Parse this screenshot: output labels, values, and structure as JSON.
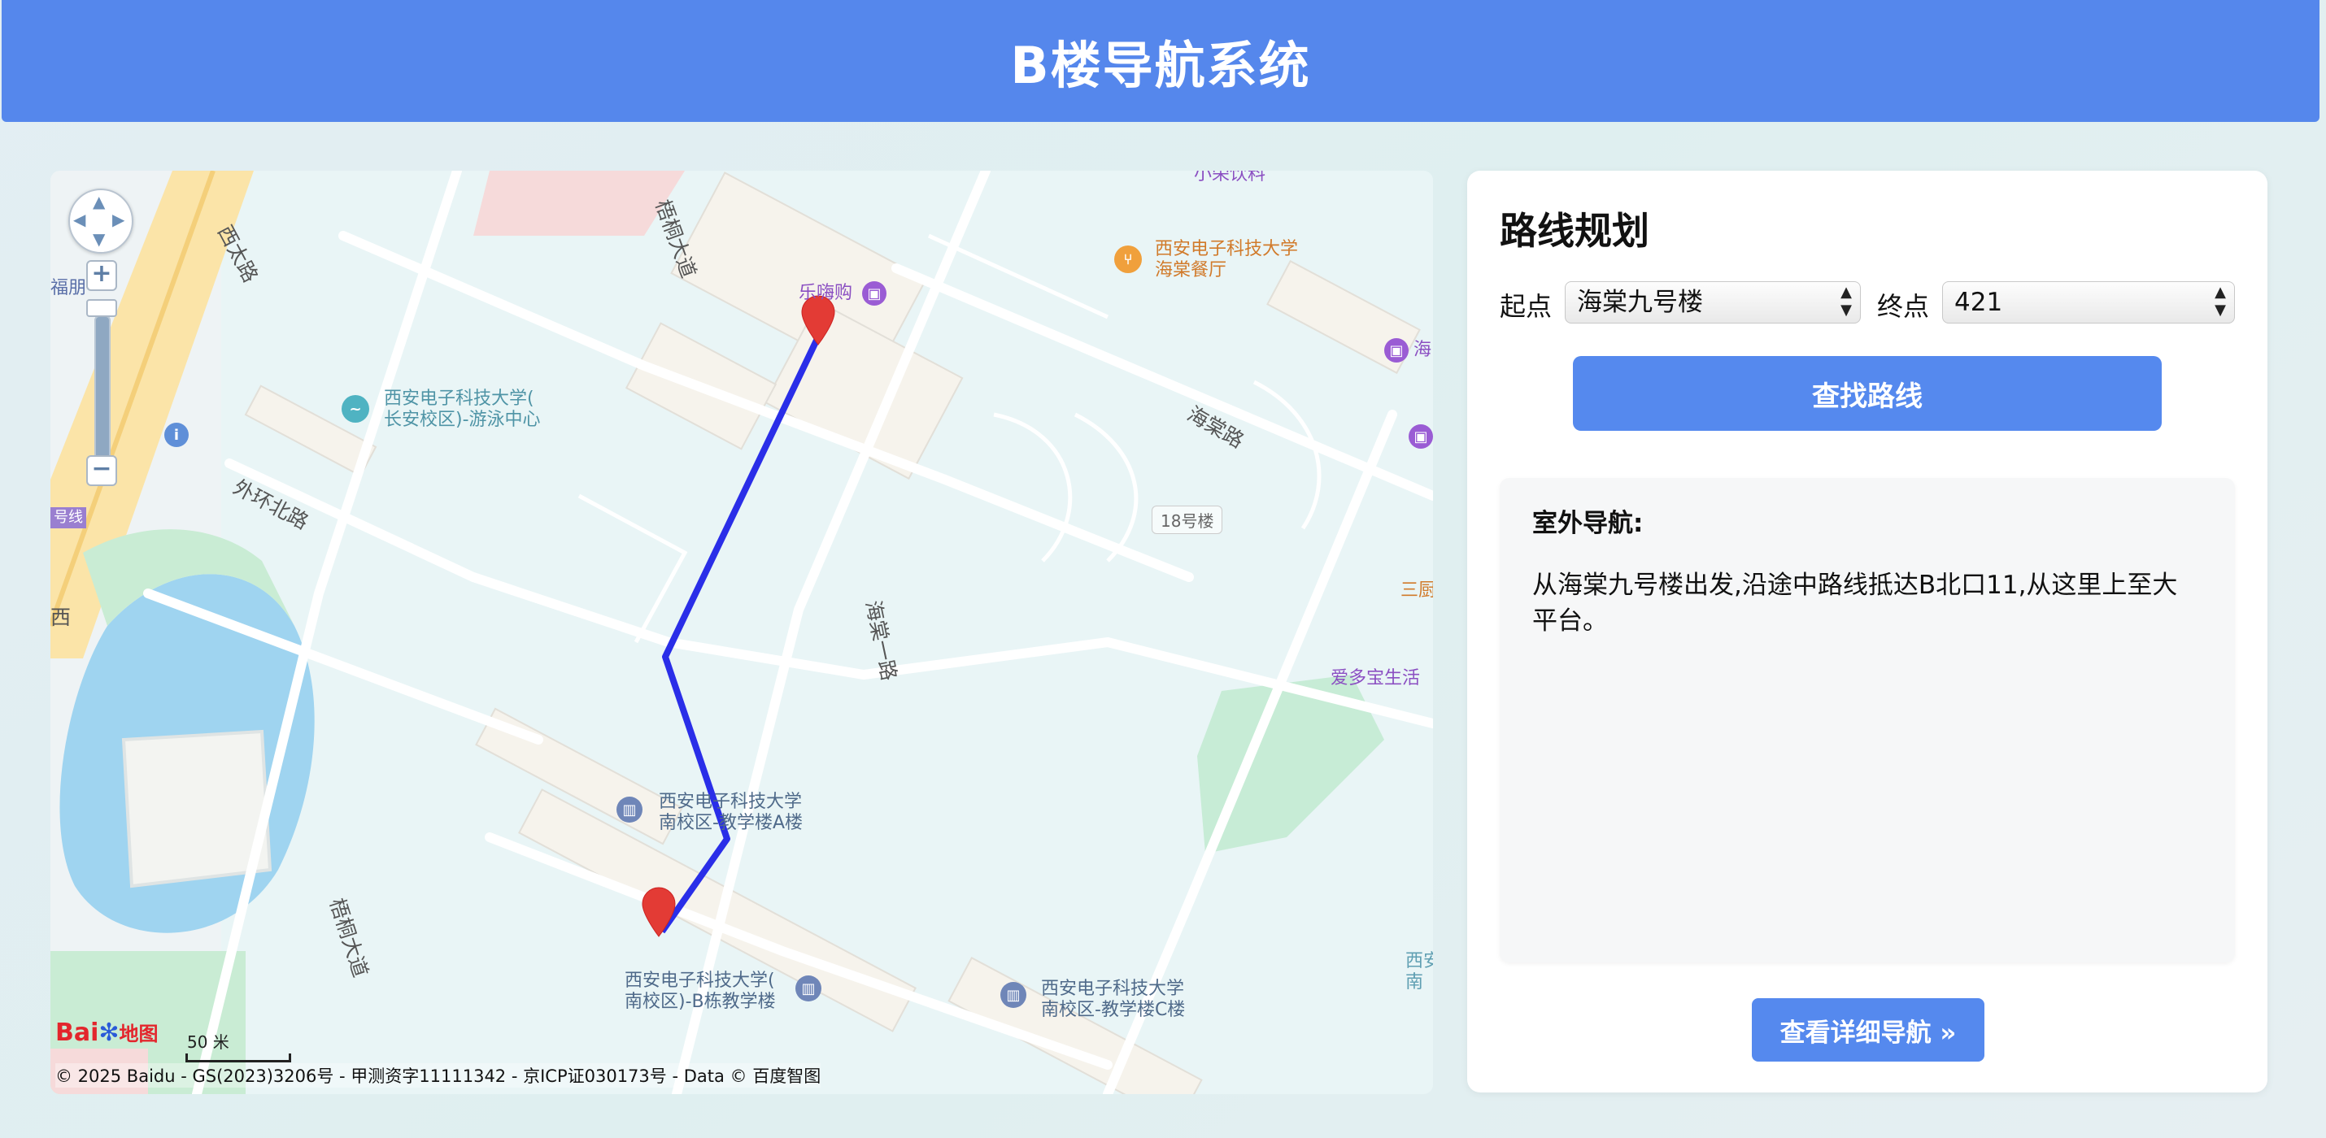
{
  "header": {
    "title": "B楼导航系统"
  },
  "map": {
    "labels": {
      "west_road": "西太路",
      "tongtong_north": "梧桐大道",
      "tongtong_south": "梧桐大道",
      "outer_ring": "外环北路",
      "haitang_road": "海棠路",
      "haitang_one": "海棠一路",
      "swim": "西安电子科技大学(\n长安校区)-游泳中心",
      "canteen": "西安电子科技大学\n海棠餐厅",
      "happy": "乐嗨购",
      "drink": "小荣饮料",
      "bldg18": "18号楼",
      "teachA": "西安电子科技大学\n南校区-教学楼A楼",
      "teachB": "西安电子科技大学(\n南校区)-B栋教学楼",
      "teachC": "西安电子科技大学\n南校区-教学楼C楼",
      "aiduo": "爱多宝生活",
      "sanchu": "三厨",
      "hai": "海",
      "xian": "西安\n南",
      "mingpeng": "福朋",
      "line": "号线",
      "xi": "西"
    },
    "scale": "50 米",
    "logo_text": "Bai",
    "logo_suffix": "地图",
    "copyright": "© 2025 Baidu - GS(2023)3206号 - 甲测资字11111342 - 京ICP证030173号 - Data © 百度智图"
  },
  "panel": {
    "title": "路线规划",
    "start_label": "起点",
    "start_value": "海棠九号楼",
    "end_label": "终点",
    "end_value": "421",
    "find_button": "查找路线",
    "result_title": "室外导航:",
    "result_text": "从海棠九号楼出发,沿途中路线抵达B北口11,从这里上至大平台。",
    "detail_button": "查看详细导航 »"
  },
  "colors": {
    "accent": "#5587ec",
    "route": "#2a2ee8",
    "marker": "#e33b35"
  }
}
